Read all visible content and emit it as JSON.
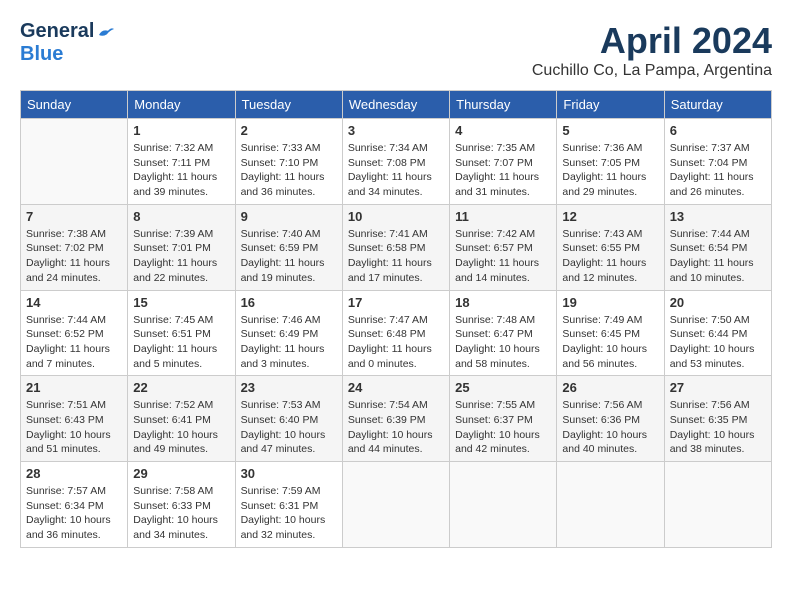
{
  "header": {
    "logo_general": "General",
    "logo_blue": "Blue",
    "title": "April 2024",
    "location": "Cuchillo Co, La Pampa, Argentina"
  },
  "weekdays": [
    "Sunday",
    "Monday",
    "Tuesday",
    "Wednesday",
    "Thursday",
    "Friday",
    "Saturday"
  ],
  "weeks": [
    {
      "shaded": false,
      "days": [
        {
          "num": "",
          "empty": true
        },
        {
          "num": "1",
          "sunrise": "Sunrise: 7:32 AM",
          "sunset": "Sunset: 7:11 PM",
          "daylight": "Daylight: 11 hours and 39 minutes."
        },
        {
          "num": "2",
          "sunrise": "Sunrise: 7:33 AM",
          "sunset": "Sunset: 7:10 PM",
          "daylight": "Daylight: 11 hours and 36 minutes."
        },
        {
          "num": "3",
          "sunrise": "Sunrise: 7:34 AM",
          "sunset": "Sunset: 7:08 PM",
          "daylight": "Daylight: 11 hours and 34 minutes."
        },
        {
          "num": "4",
          "sunrise": "Sunrise: 7:35 AM",
          "sunset": "Sunset: 7:07 PM",
          "daylight": "Daylight: 11 hours and 31 minutes."
        },
        {
          "num": "5",
          "sunrise": "Sunrise: 7:36 AM",
          "sunset": "Sunset: 7:05 PM",
          "daylight": "Daylight: 11 hours and 29 minutes."
        },
        {
          "num": "6",
          "sunrise": "Sunrise: 7:37 AM",
          "sunset": "Sunset: 7:04 PM",
          "daylight": "Daylight: 11 hours and 26 minutes."
        }
      ]
    },
    {
      "shaded": true,
      "days": [
        {
          "num": "7",
          "sunrise": "Sunrise: 7:38 AM",
          "sunset": "Sunset: 7:02 PM",
          "daylight": "Daylight: 11 hours and 24 minutes."
        },
        {
          "num": "8",
          "sunrise": "Sunrise: 7:39 AM",
          "sunset": "Sunset: 7:01 PM",
          "daylight": "Daylight: 11 hours and 22 minutes."
        },
        {
          "num": "9",
          "sunrise": "Sunrise: 7:40 AM",
          "sunset": "Sunset: 6:59 PM",
          "daylight": "Daylight: 11 hours and 19 minutes."
        },
        {
          "num": "10",
          "sunrise": "Sunrise: 7:41 AM",
          "sunset": "Sunset: 6:58 PM",
          "daylight": "Daylight: 11 hours and 17 minutes."
        },
        {
          "num": "11",
          "sunrise": "Sunrise: 7:42 AM",
          "sunset": "Sunset: 6:57 PM",
          "daylight": "Daylight: 11 hours and 14 minutes."
        },
        {
          "num": "12",
          "sunrise": "Sunrise: 7:43 AM",
          "sunset": "Sunset: 6:55 PM",
          "daylight": "Daylight: 11 hours and 12 minutes."
        },
        {
          "num": "13",
          "sunrise": "Sunrise: 7:44 AM",
          "sunset": "Sunset: 6:54 PM",
          "daylight": "Daylight: 11 hours and 10 minutes."
        }
      ]
    },
    {
      "shaded": false,
      "days": [
        {
          "num": "14",
          "sunrise": "Sunrise: 7:44 AM",
          "sunset": "Sunset: 6:52 PM",
          "daylight": "Daylight: 11 hours and 7 minutes."
        },
        {
          "num": "15",
          "sunrise": "Sunrise: 7:45 AM",
          "sunset": "Sunset: 6:51 PM",
          "daylight": "Daylight: 11 hours and 5 minutes."
        },
        {
          "num": "16",
          "sunrise": "Sunrise: 7:46 AM",
          "sunset": "Sunset: 6:49 PM",
          "daylight": "Daylight: 11 hours and 3 minutes."
        },
        {
          "num": "17",
          "sunrise": "Sunrise: 7:47 AM",
          "sunset": "Sunset: 6:48 PM",
          "daylight": "Daylight: 11 hours and 0 minutes."
        },
        {
          "num": "18",
          "sunrise": "Sunrise: 7:48 AM",
          "sunset": "Sunset: 6:47 PM",
          "daylight": "Daylight: 10 hours and 58 minutes."
        },
        {
          "num": "19",
          "sunrise": "Sunrise: 7:49 AM",
          "sunset": "Sunset: 6:45 PM",
          "daylight": "Daylight: 10 hours and 56 minutes."
        },
        {
          "num": "20",
          "sunrise": "Sunrise: 7:50 AM",
          "sunset": "Sunset: 6:44 PM",
          "daylight": "Daylight: 10 hours and 53 minutes."
        }
      ]
    },
    {
      "shaded": true,
      "days": [
        {
          "num": "21",
          "sunrise": "Sunrise: 7:51 AM",
          "sunset": "Sunset: 6:43 PM",
          "daylight": "Daylight: 10 hours and 51 minutes."
        },
        {
          "num": "22",
          "sunrise": "Sunrise: 7:52 AM",
          "sunset": "Sunset: 6:41 PM",
          "daylight": "Daylight: 10 hours and 49 minutes."
        },
        {
          "num": "23",
          "sunrise": "Sunrise: 7:53 AM",
          "sunset": "Sunset: 6:40 PM",
          "daylight": "Daylight: 10 hours and 47 minutes."
        },
        {
          "num": "24",
          "sunrise": "Sunrise: 7:54 AM",
          "sunset": "Sunset: 6:39 PM",
          "daylight": "Daylight: 10 hours and 44 minutes."
        },
        {
          "num": "25",
          "sunrise": "Sunrise: 7:55 AM",
          "sunset": "Sunset: 6:37 PM",
          "daylight": "Daylight: 10 hours and 42 minutes."
        },
        {
          "num": "26",
          "sunrise": "Sunrise: 7:56 AM",
          "sunset": "Sunset: 6:36 PM",
          "daylight": "Daylight: 10 hours and 40 minutes."
        },
        {
          "num": "27",
          "sunrise": "Sunrise: 7:56 AM",
          "sunset": "Sunset: 6:35 PM",
          "daylight": "Daylight: 10 hours and 38 minutes."
        }
      ]
    },
    {
      "shaded": false,
      "days": [
        {
          "num": "28",
          "sunrise": "Sunrise: 7:57 AM",
          "sunset": "Sunset: 6:34 PM",
          "daylight": "Daylight: 10 hours and 36 minutes."
        },
        {
          "num": "29",
          "sunrise": "Sunrise: 7:58 AM",
          "sunset": "Sunset: 6:33 PM",
          "daylight": "Daylight: 10 hours and 34 minutes."
        },
        {
          "num": "30",
          "sunrise": "Sunrise: 7:59 AM",
          "sunset": "Sunset: 6:31 PM",
          "daylight": "Daylight: 10 hours and 32 minutes."
        },
        {
          "num": "",
          "empty": true
        },
        {
          "num": "",
          "empty": true
        },
        {
          "num": "",
          "empty": true
        },
        {
          "num": "",
          "empty": true
        }
      ]
    }
  ]
}
